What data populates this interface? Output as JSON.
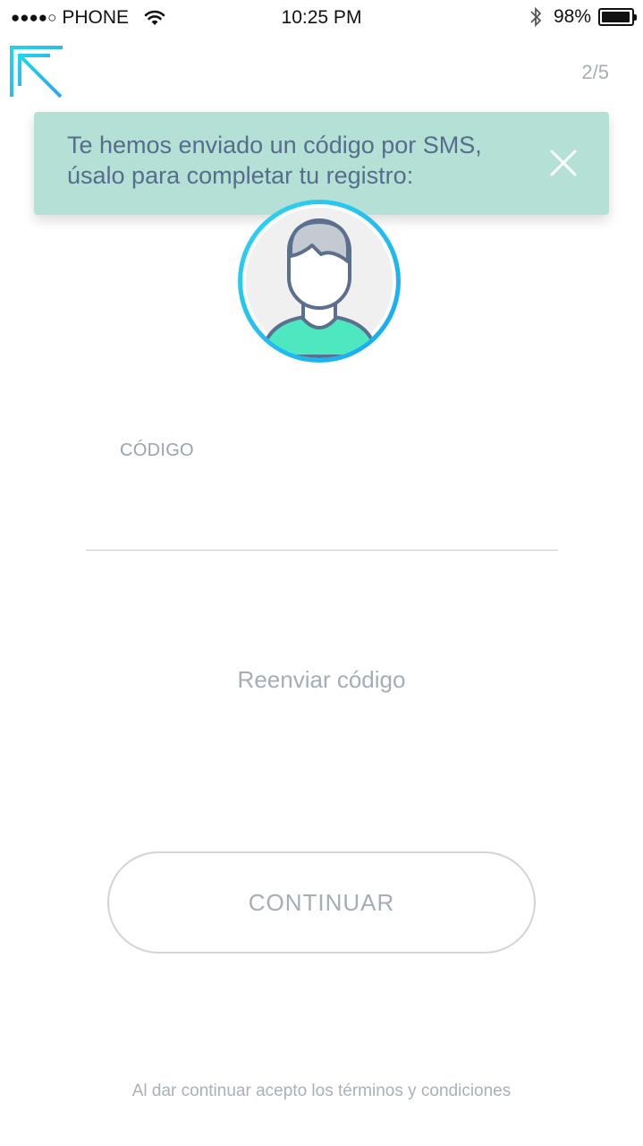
{
  "status_bar": {
    "signal": "●●●●○",
    "carrier": "PHONE",
    "time": "10:25 PM",
    "battery_percent": "98%",
    "battery_level": 0.98,
    "icons": [
      "wifi-icon",
      "bluetooth-icon",
      "battery-icon"
    ]
  },
  "header": {
    "logo_icon": "brand-logo-arrow-icon",
    "step": "2/5"
  },
  "toast": {
    "message": "Te hemos enviado un código por SMS, úsalo para completar tu registro:",
    "close_icon": "close-icon",
    "background": "#b4e0d5"
  },
  "avatar": {
    "icon": "user-avatar-icon",
    "ring_color": "#22c6f0",
    "shirt_color": "#4de8c0"
  },
  "form": {
    "code_label": "CÓDIGO",
    "code_value": "",
    "resend_label": "Reenviar código",
    "continue_label": "CONTINUAR"
  },
  "footer": {
    "terms": "Al dar continuar acepto los términos y condiciones"
  },
  "colors": {
    "accent_cyan": "#22c6f0",
    "accent_green": "#4de8c0",
    "muted_text": "#a5adb6",
    "toast_text": "#566d8c"
  }
}
